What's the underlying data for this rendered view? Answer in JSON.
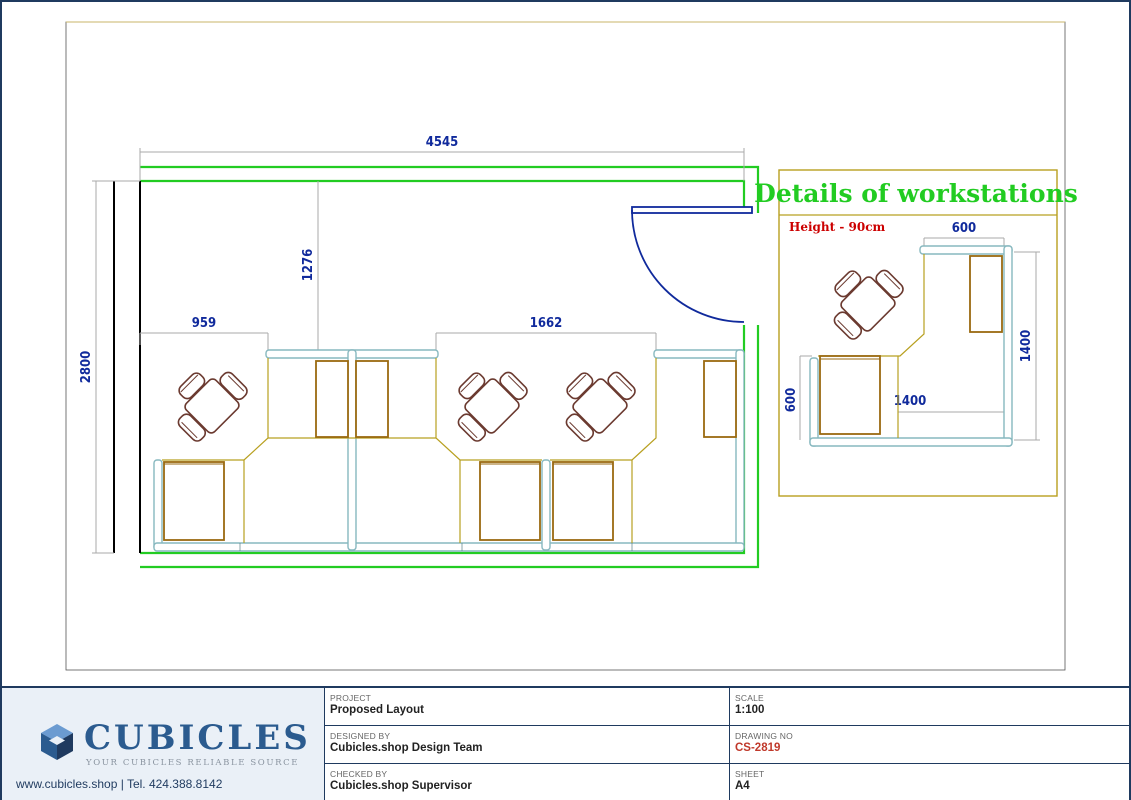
{
  "plan": {
    "dim_total_width": "4545",
    "dim_total_height": "2800",
    "dim_to_desks": "1276",
    "dim_left_desk": "959",
    "dim_mid_desk": "1662"
  },
  "detail": {
    "title": "Details of workstations",
    "height_note": "Height - 90cm",
    "dim_top": "600",
    "dim_right": "1400",
    "dim_bottom": "1400",
    "dim_left": "600"
  },
  "titleblock": {
    "brand_name": "CUBICLES",
    "brand_tagline": "YOUR CUBICLES RELIABLE SOURCE",
    "brand_contact": "www.cubicles.shop  |  Tel. 424.388.8142",
    "project_label": "PROJECT",
    "project_value": "Proposed Layout",
    "scale_label": "SCALE",
    "scale_value": "1:100",
    "designed_label": "DESIGNED BY",
    "designed_value": "Cubicles.shop Design Team",
    "drawing_label": "DRAWING NO",
    "drawing_value": "CS-2819",
    "checked_label": "CHECKED BY",
    "checked_value": "Cubicles.shop Supervisor",
    "sheet_label": "SHEET",
    "sheet_value": "A4"
  },
  "colors": {
    "wall": "#22cc22",
    "dimension": "#102a9c",
    "partition": "#87b8bf",
    "desk": "#9a6a10",
    "chair": "#6b3a30",
    "detail_title": "#22cc22",
    "height_note": "#cc0000",
    "frame": "#1f3a5f"
  }
}
